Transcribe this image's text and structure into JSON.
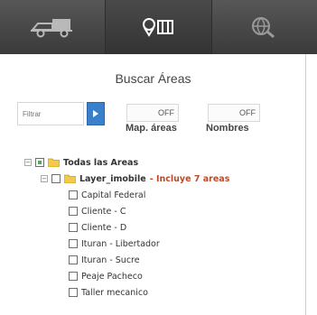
{
  "toolbar": {
    "tabs": [
      {
        "name": "vehicles",
        "icon": "truck-icon"
      },
      {
        "name": "areas",
        "icon": "map-pin-icon"
      },
      {
        "name": "search",
        "icon": "globe-search-icon"
      }
    ]
  },
  "panel": {
    "title": "Buscar Áreas",
    "filter_placeholder": "Filtrar",
    "toggles": [
      {
        "state": "OFF",
        "label": "Map. áreas"
      },
      {
        "state": "OFF",
        "label": "Nombres"
      }
    ]
  },
  "tree": {
    "root_label": "Todas las Areas",
    "layer": {
      "label": "Layer_imobile",
      "note": "- Incluye 7 areas"
    },
    "items": [
      "Capital Federal",
      "Cliente - C",
      "Cliente - D",
      "Ituran - Libertador",
      "Ituran - Sucre",
      "Peaje Pacheco",
      "Taller mecanico"
    ]
  }
}
